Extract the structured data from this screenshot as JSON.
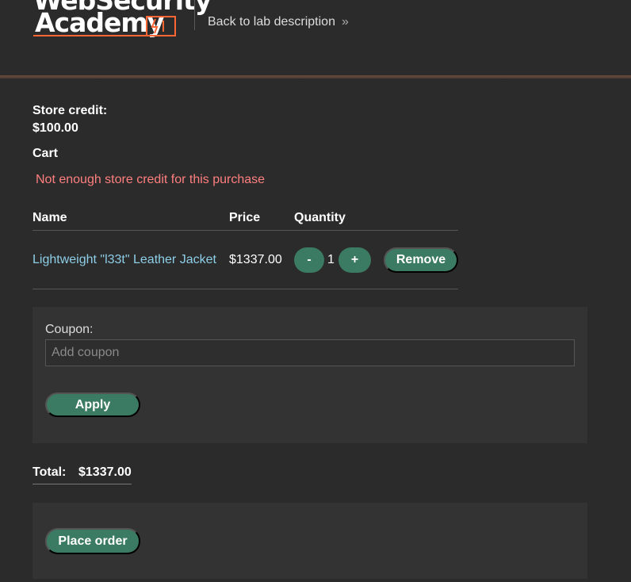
{
  "header": {
    "logo_line1": "WebSecurity",
    "logo_line2": "Academy",
    "back_link": "Back to lab description",
    "chevron_glyph": "»"
  },
  "store": {
    "credit_label": "Store credit:",
    "credit_value": "$100.00"
  },
  "cart": {
    "title": "Cart",
    "error": "Not enough store credit for this purchase",
    "columns": [
      "Name",
      "Price",
      "Quantity"
    ],
    "items": [
      {
        "name": "Lightweight \"l33t\" Leather Jacket",
        "price": "$1337.00",
        "quantity": "1",
        "minus_label": "-",
        "plus_label": "+",
        "remove_label": "Remove"
      }
    ]
  },
  "coupon": {
    "label": "Coupon:",
    "placeholder": "Add coupon",
    "apply_label": "Apply"
  },
  "total": {
    "label": "Total:",
    "value": "$1337.00"
  },
  "order": {
    "place_label": "Place order"
  },
  "colors": {
    "background": "#2b2b2b",
    "panel": "#333333",
    "accent_button": "#3b7a63",
    "link": "#8ecfe8",
    "error": "#ff7f7f",
    "brand_orange": "#ff6633"
  }
}
